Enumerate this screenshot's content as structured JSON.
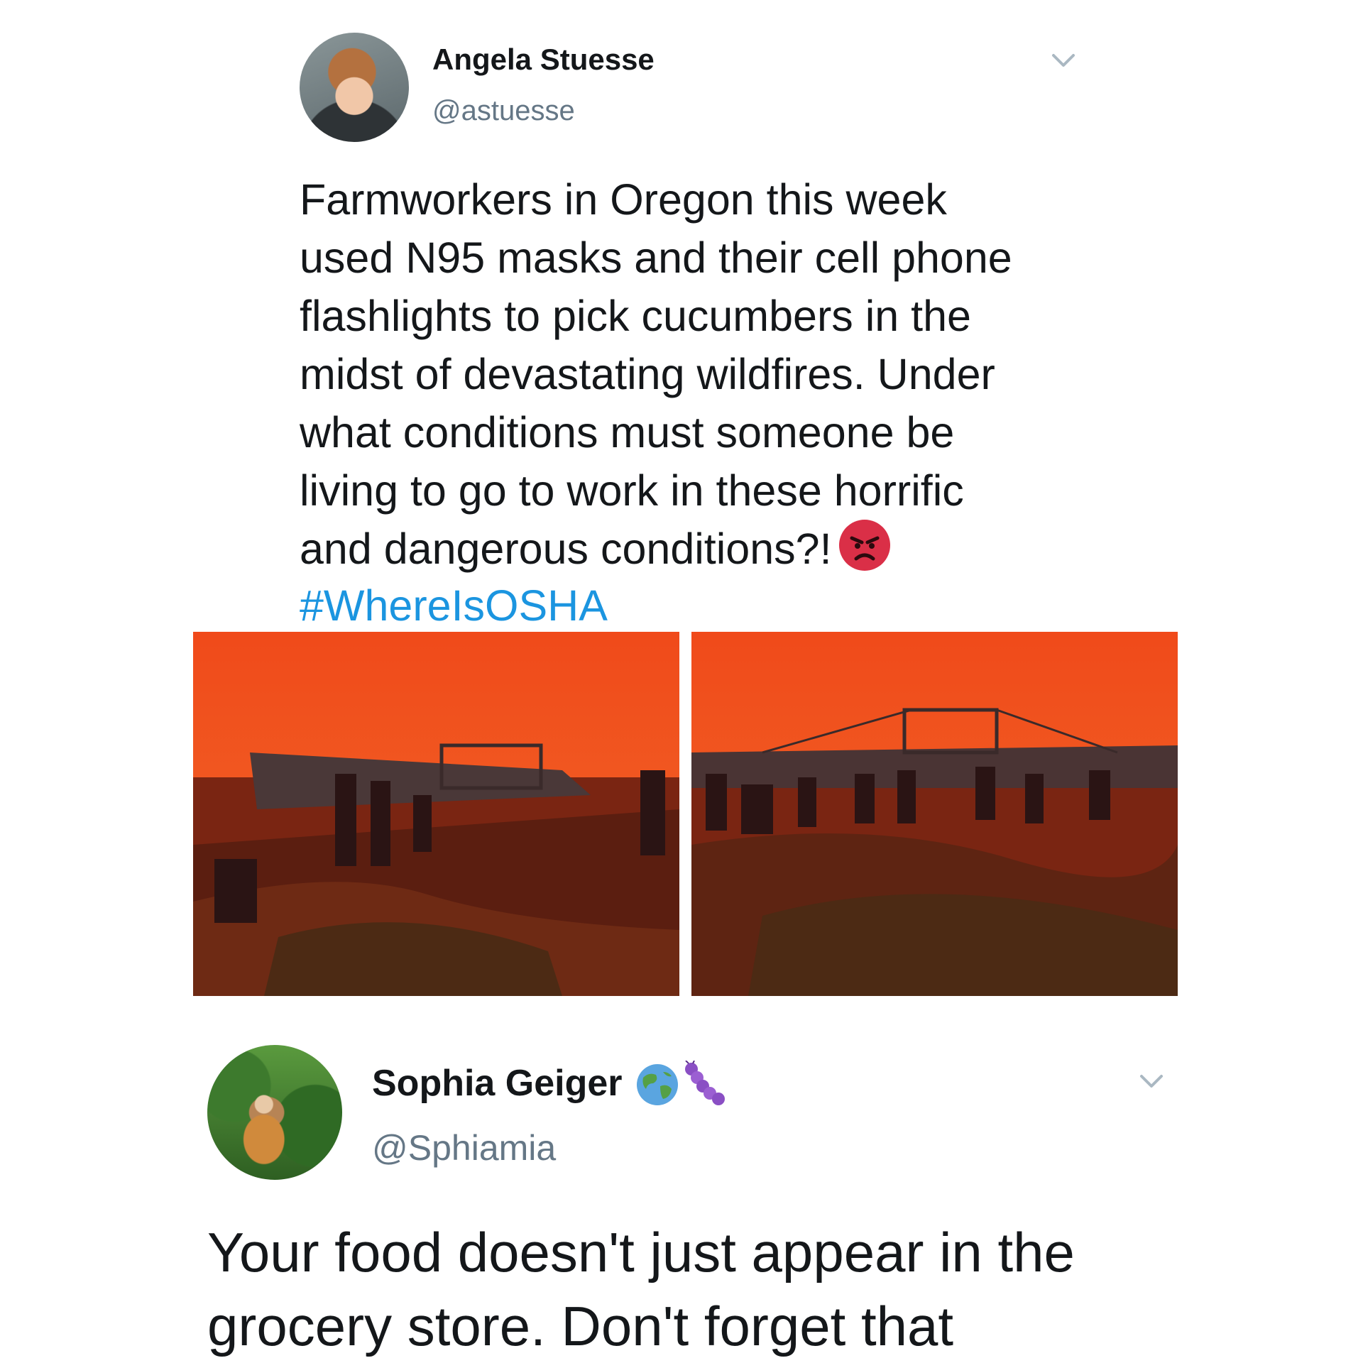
{
  "tweets": [
    {
      "author_name": "Angela Stuesse",
      "handle": "@astuesse",
      "text": "Farmworkers in Oregon this week\nused N95 masks and their cell phone\nflashlights to pick cucumbers in the\nmidst of devastating wildfires. Under\nwhat conditions must someone be\nliving to go to work in these horrific\nand dangerous conditions?!",
      "emoji": "angry-face-icon",
      "hashtag": "#WhereIsOSHA",
      "media": [
        "farm-field-photo",
        "farm-field-photo"
      ]
    },
    {
      "author_name": "Sophia Geiger",
      "name_emojis": [
        "globe-icon",
        "caterpillar-icon"
      ],
      "handle": "@Sphiamia",
      "text": "Your food doesn't just appear in the\ngrocery store. Don't forget that"
    }
  ],
  "colors": {
    "text": "#14171a",
    "handle": "#657786",
    "hashtag": "#1b95e0",
    "sky": "#f2581f",
    "angry_emoji": "#da2f47"
  }
}
